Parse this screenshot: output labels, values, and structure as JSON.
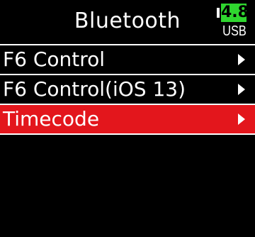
{
  "header": {
    "title": "Bluetooth",
    "battery": {
      "level_text": "4.8",
      "source_text": "USB",
      "level_color": "#2fd62f"
    }
  },
  "menu": {
    "items": [
      {
        "label": "F6 Control",
        "icon": "chevron-right-icon",
        "selected": false
      },
      {
        "label": "F6 Control(iOS 13)",
        "icon": "chevron-right-icon",
        "selected": false
      },
      {
        "label": "Timecode",
        "icon": "chevron-right-icon",
        "selected": true
      }
    ]
  },
  "colors": {
    "background": "#000000",
    "text": "#ffffff",
    "selection": "#e3161c",
    "divider": "#ffffff"
  }
}
